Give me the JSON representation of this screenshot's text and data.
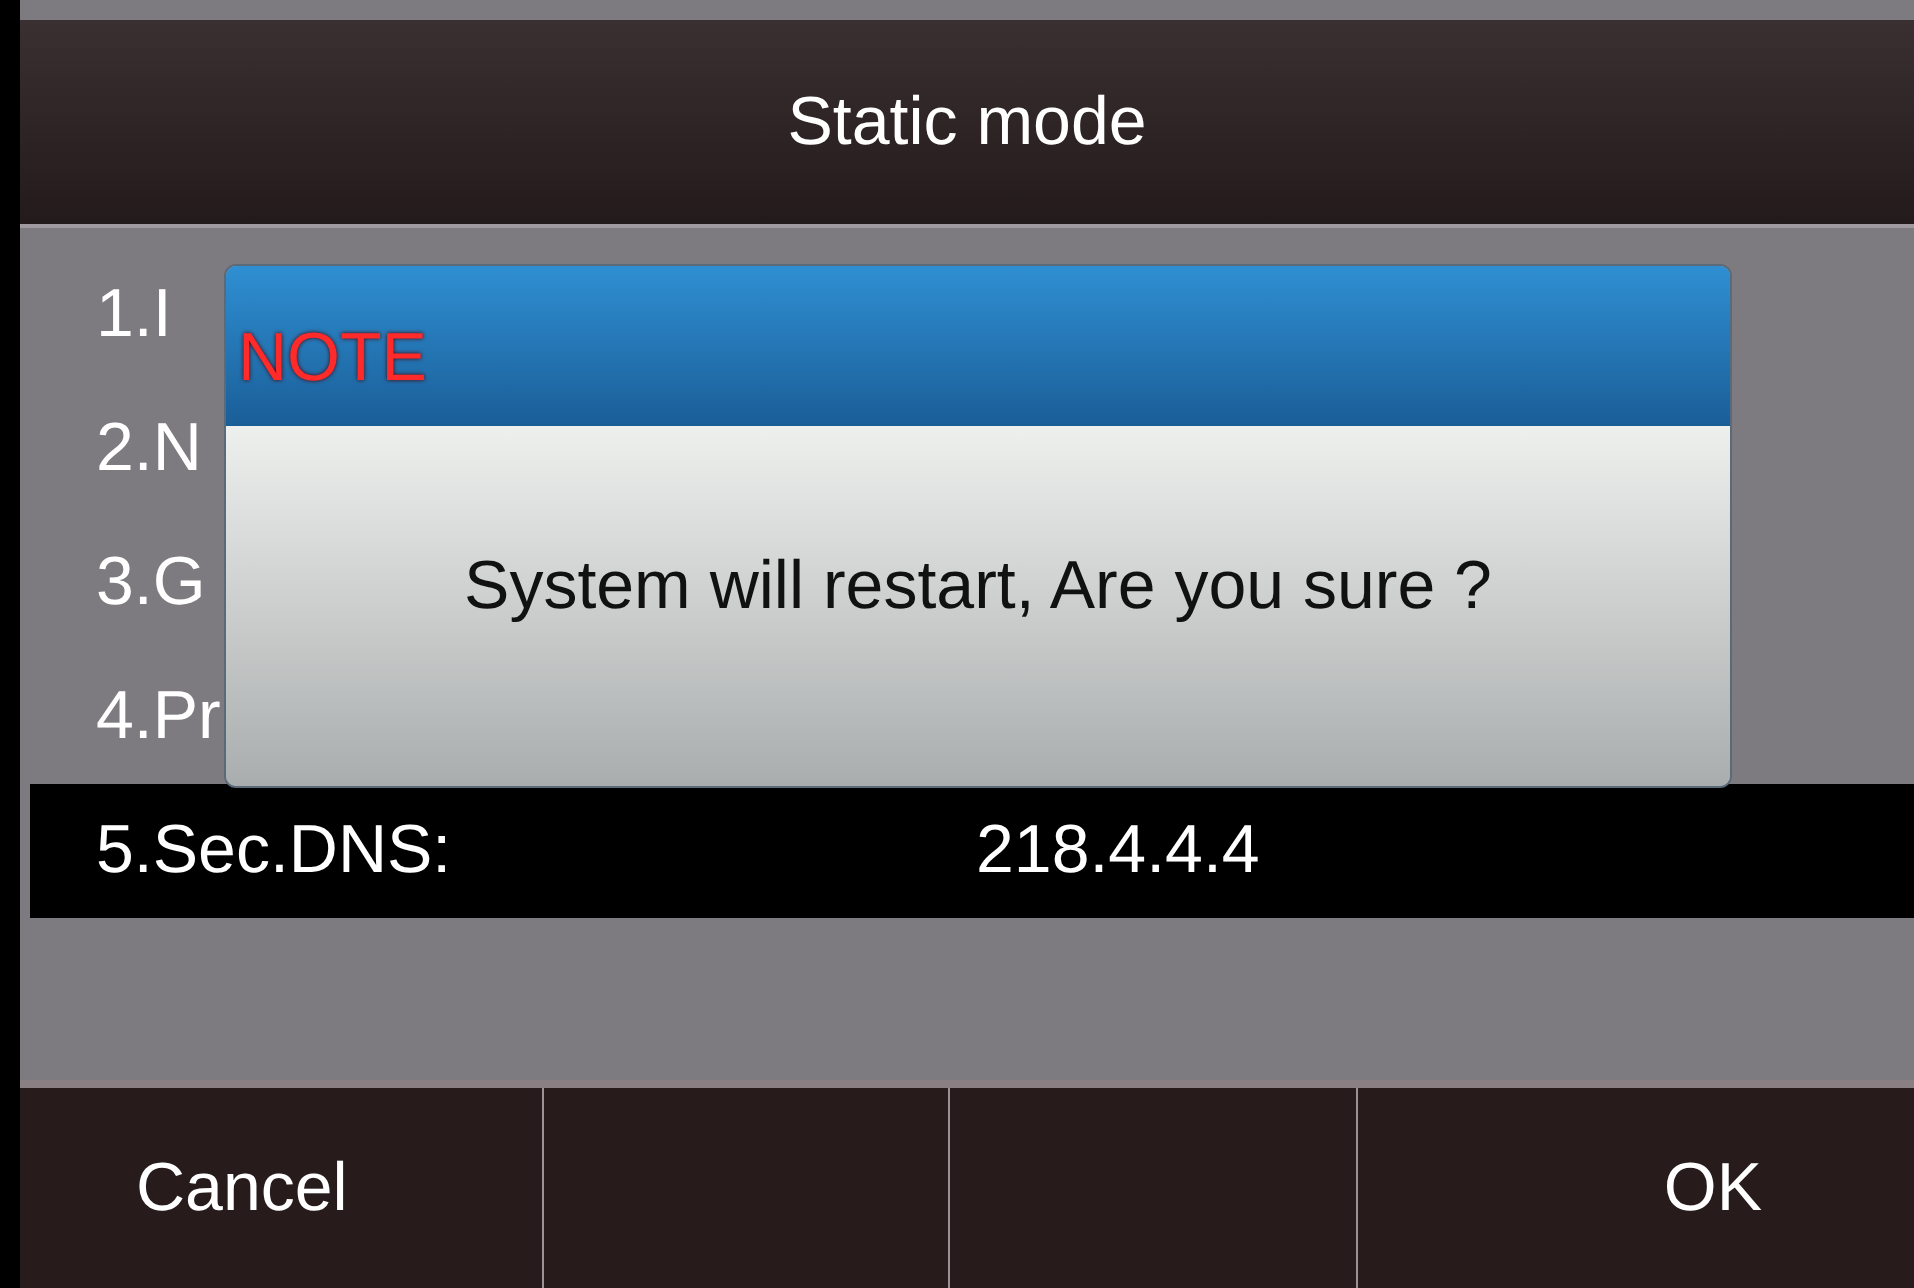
{
  "header": {
    "title": "Static mode"
  },
  "rows": [
    {
      "label": "1.I",
      "selected": false
    },
    {
      "label": "2.N",
      "selected": false
    },
    {
      "label": "3.G",
      "selected": false
    },
    {
      "label": "4.Pr",
      "selected": false
    },
    {
      "label": "5.Sec.DNS:",
      "value": "218.4.4.4",
      "selected": true
    }
  ],
  "dialog": {
    "title": "NOTE",
    "message": "System will restart, Are you sure ?"
  },
  "softkeys": {
    "left": "Cancel",
    "right": "OK"
  }
}
